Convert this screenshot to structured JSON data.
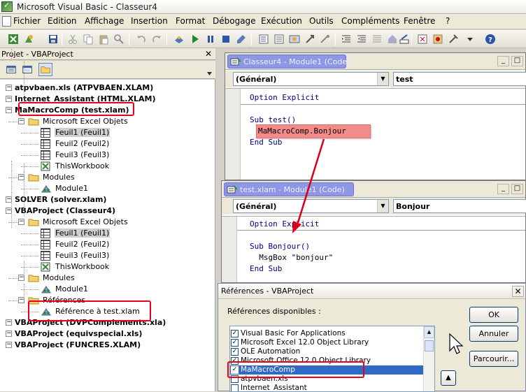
{
  "window": {
    "title": "Microsoft Visual Basic - Classeur4"
  },
  "menu": [
    "Fichier",
    "Edition",
    "Affichage",
    "Insertion",
    "Format",
    "Débogage",
    "Exécution",
    "Outils",
    "Compléments",
    "Fenêtre",
    "?"
  ],
  "project": {
    "title": "Projet - VBAProject",
    "close_glyph": "✕",
    "tree": [
      {
        "label": "atpvbaen.xls (ATPVBAEN.XLAM)",
        "bold": true
      },
      {
        "label": "Internet_Assistant (HTML.XLAM)",
        "bold": true
      },
      {
        "label": "MaMacroComp (test.xlam)",
        "bold": true
      },
      {
        "label": "Microsoft Excel Objets"
      },
      {
        "label": "Feuil1 (Feuil1)"
      },
      {
        "label": "Feuil2 (Feuil2)"
      },
      {
        "label": "Feuil3 (Feuil3)"
      },
      {
        "label": "ThisWorkbook"
      },
      {
        "label": "Modules"
      },
      {
        "label": "Module1"
      },
      {
        "label": "SOLVER (solver.xlam)",
        "bold": true
      },
      {
        "label": "VBAProject (Classeur4)",
        "bold": true
      },
      {
        "label": "Microsoft Excel Objets"
      },
      {
        "label": "Feuil1 (Feuil1)"
      },
      {
        "label": "Feuil2 (Feuil2)"
      },
      {
        "label": "Feuil3 (Feuil3)"
      },
      {
        "label": "ThisWorkbook"
      },
      {
        "label": "Modules"
      },
      {
        "label": "Module1"
      },
      {
        "label": "Références"
      },
      {
        "label": "Référence à test.xlam"
      },
      {
        "label": "VBAProject (DVPComplements.xla)",
        "bold": true
      },
      {
        "label": "VBAProject (equivspecial.xls)",
        "bold": true
      },
      {
        "label": "VBAProject (FUNCRES.XLAM)",
        "bold": true
      }
    ]
  },
  "code1": {
    "title": "Classeur4 - Module1 (Code)",
    "combo_left": "(Général)",
    "combo_right": "test",
    "lines": [
      "Option Explicit",
      "",
      "Sub test()",
      "",
      "End Sub"
    ],
    "callout": "MaMacroComp.Bonjour"
  },
  "code2": {
    "title": "test.xlam - Module1 (Code)",
    "combo_left": "(Général)",
    "combo_right": "Bonjour",
    "lines": [
      "Option Explicit",
      "",
      "Sub Bonjour()",
      "  MsgBox \"bonjour\"",
      "End Sub"
    ]
  },
  "window_buttons": {
    "minimize": "_",
    "maximize": "□"
  },
  "references": {
    "title": "Références - VBAProject",
    "close_glyph": "✕",
    "available_label": "Références disponibles :",
    "items": [
      {
        "name": "Visual Basic For Applications",
        "checked": true
      },
      {
        "name": "Microsoft Excel 12.0 Object Library",
        "checked": true
      },
      {
        "name": "OLE Automation",
        "checked": true
      },
      {
        "name": "Microsoft Office 12.0 Object Library",
        "checked": true
      },
      {
        "name": "MaMacroComp",
        "checked": true,
        "selected": true
      },
      {
        "name": "atpvbaen.xls",
        "checked": false
      },
      {
        "name": "Internet_Assistant",
        "checked": false
      }
    ],
    "ok": "OK",
    "cancel": "Annuler",
    "browse": "Parcourir...",
    "priority_up": "▲"
  },
  "colors": {
    "highlight_red": "#e8001c",
    "callout_bg": "#f48b8b",
    "title_pill": "#8e96e6",
    "selection_blue": "#316ac5"
  }
}
